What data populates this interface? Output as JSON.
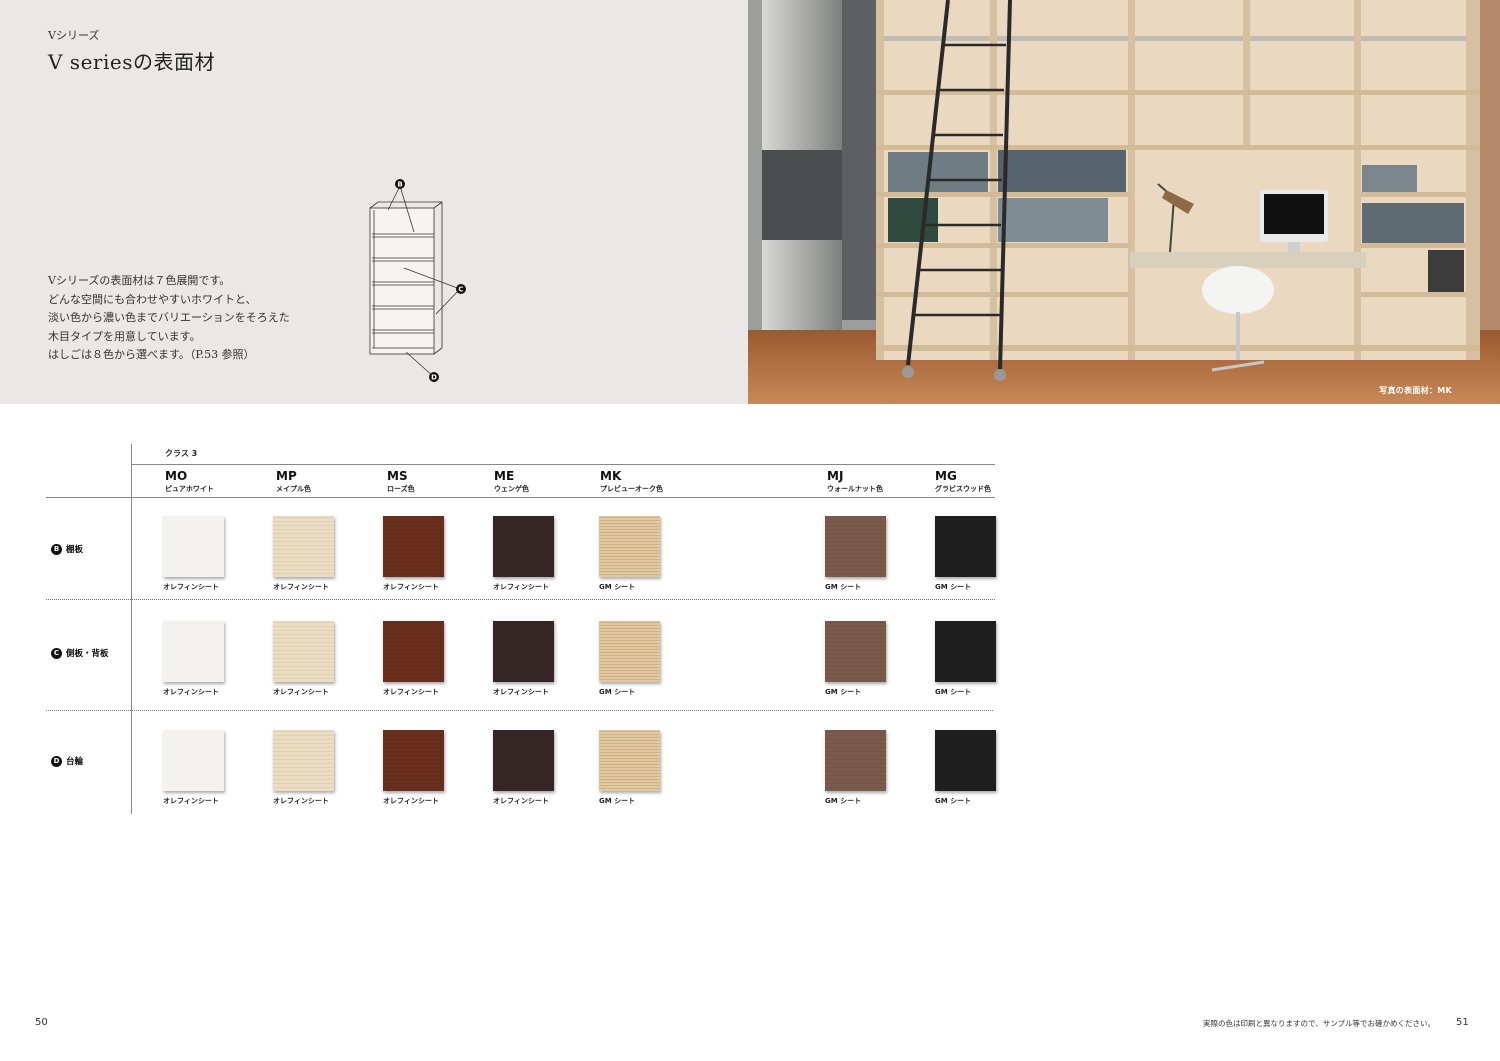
{
  "header": {
    "series_sub": "Vシリーズ",
    "title": "V seriesの表面材"
  },
  "intro": [
    "Vシリーズの表面材は７色展開です。",
    "どんな空間にも合わせやすいホワイトと、",
    "淡い色から濃い色までバリエーションをそろえた",
    "木目タイプを用意しています。",
    "はしごは８色から選べます。（P.53 参照）"
  ],
  "diagram": {
    "labels": [
      "B",
      "C",
      "D"
    ]
  },
  "photo": {
    "caption": "写真の表面材：MK"
  },
  "table": {
    "class_label": "クラス 3",
    "columns": [
      {
        "code": "MO",
        "name": "ピュアホワイト"
      },
      {
        "code": "MP",
        "name": "メイプル色"
      },
      {
        "code": "MS",
        "name": "ローズ色"
      },
      {
        "code": "ME",
        "name": "ウェンゲ色"
      },
      {
        "code": "MK",
        "name": "プレビューオーク色"
      },
      {
        "code": "MJ",
        "name": "ウォールナット色"
      },
      {
        "code": "MG",
        "name": "グラビスウッド色"
      }
    ],
    "rows": [
      {
        "badge": "B",
        "label": "棚板",
        "materials": [
          "オレフィンシート",
          "オレフィンシート",
          "オレフィンシート",
          "オレフィンシート",
          "GM シート",
          "GM シート",
          "GM シート"
        ]
      },
      {
        "badge": "C",
        "label": "側板・背板",
        "materials": [
          "オレフィンシート",
          "オレフィンシート",
          "オレフィンシート",
          "オレフィンシート",
          "GM シート",
          "GM シート",
          "GM シート"
        ]
      },
      {
        "badge": "D",
        "label": "台輪",
        "materials": [
          "オレフィンシート",
          "オレフィンシート",
          "オレフィンシート",
          "オレフィンシート",
          "GM シート",
          "GM シート",
          "GM シート"
        ]
      }
    ],
    "swatch_colors": [
      "#f4f2ee",
      "#ecdcc1",
      "#6a2e1d",
      "#362626",
      "#e1c9a1",
      "#7a5a4a",
      "#1f1f1f"
    ]
  },
  "footer": {
    "page_left": "50",
    "page_right": "51",
    "note": "実際の色は印刷と異なりますので、サンプル等でお確かめください。"
  }
}
